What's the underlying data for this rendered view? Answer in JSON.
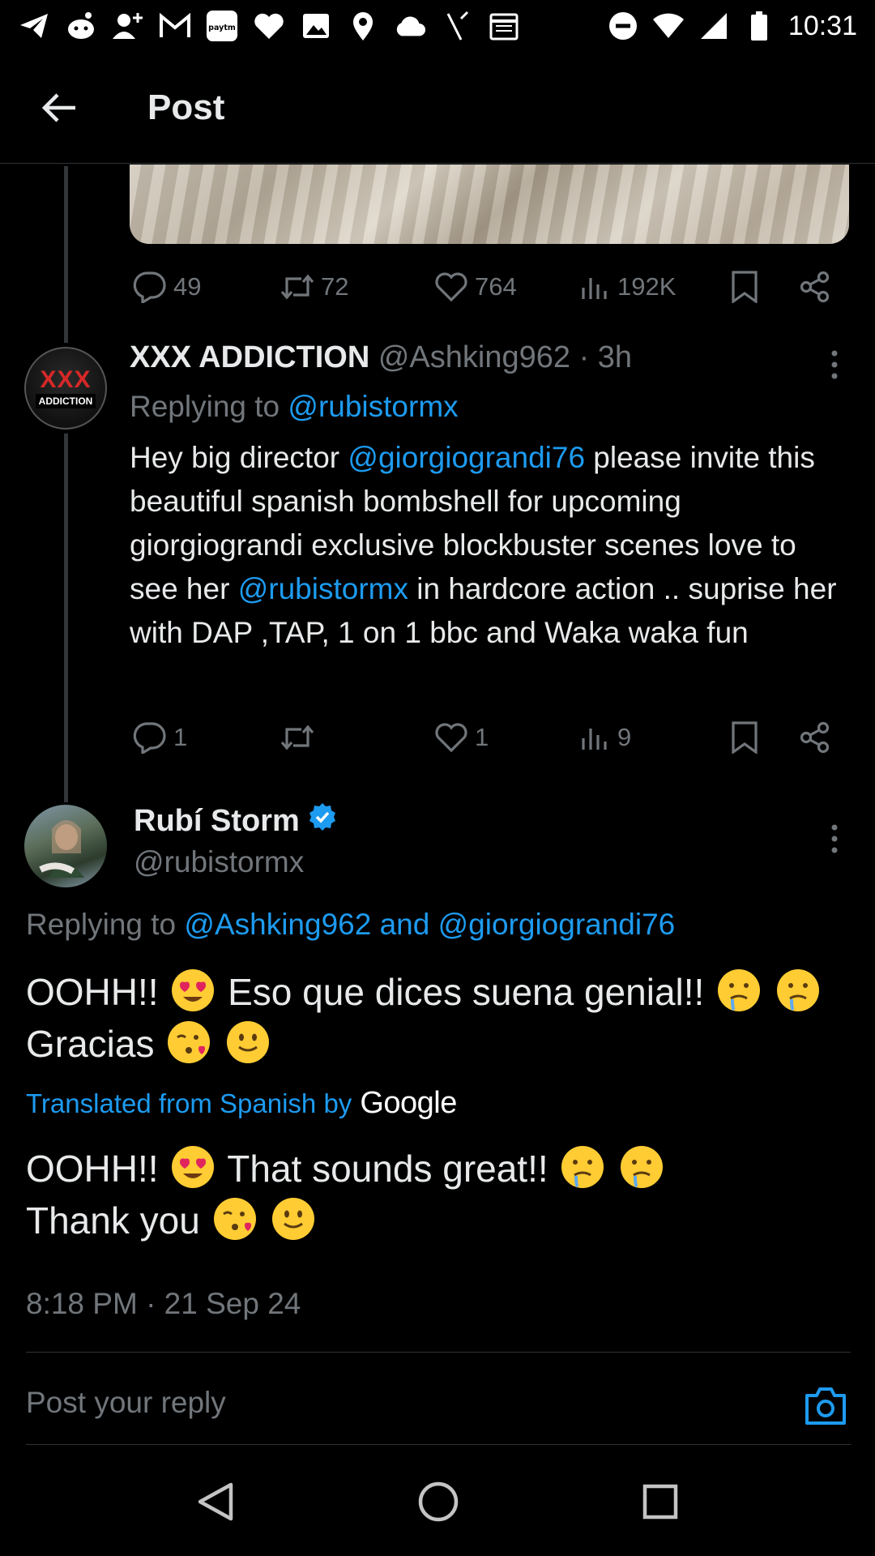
{
  "status_bar": {
    "time": "10:31",
    "left_icons": [
      "telegram-icon",
      "reddit-icon",
      "add-contact-icon",
      "gmail-icon",
      "paytm-icon",
      "heart-icon",
      "gallery-icon",
      "location-icon",
      "cloud-icon",
      "slash-icon",
      "calendar-icon"
    ],
    "paytm_label": "paytm",
    "right_icons": [
      "do-not-disturb-icon",
      "wifi-icon",
      "signal-icon",
      "battery-icon"
    ]
  },
  "header": {
    "title": "Post"
  },
  "parent_post": {
    "actions": {
      "replies": "49",
      "reposts": "72",
      "likes": "764",
      "views": "192K"
    }
  },
  "reply1": {
    "avatar": {
      "top": "XXX",
      "bottom": "ADDICTION"
    },
    "display_name": "XXX ADDICTION",
    "handle": "@Ashking962",
    "time": "· 3h",
    "replying_prefix": "Replying to",
    "replying_to": "@rubistormx",
    "body": {
      "p1": "Hey big director ",
      "m1": "@giorgiograndi76",
      "p2": "  please invite this beautiful spanish bombshell for upcoming giorgiograndi exclusive blockbuster scenes love to see her ",
      "m2": "@rubistormx",
      "p3": "  in hardcore action .. suprise her with DAP ,TAP, 1 on 1 bbc and Waka waka fun"
    },
    "actions": {
      "replies": "1",
      "reposts": "",
      "likes": "1",
      "views": "9"
    }
  },
  "main_post": {
    "display_name": "Rubí Storm",
    "handle": "@rubistormx",
    "replying_prefix": "Replying to",
    "replying_to": "@Ashking962 and @giorgiograndi76",
    "original": {
      "line1": "OOHH!!",
      "line1b": "Eso que dices suena genial!!",
      "line2": "Gracias"
    },
    "translated_label": "Translated from Spanish by",
    "translated_brand": "Google",
    "translation": {
      "line1": "OOHH!!",
      "line1b": "That sounds great!!",
      "line2": "Thank you"
    },
    "timestamp": "8:18 PM · 21 Sep 24"
  },
  "reply_box": {
    "placeholder": "Post your reply"
  },
  "colors": {
    "accent": "#1d9bf0",
    "muted": "#71767b",
    "text": "#e7e9ea",
    "background": "#000000"
  }
}
